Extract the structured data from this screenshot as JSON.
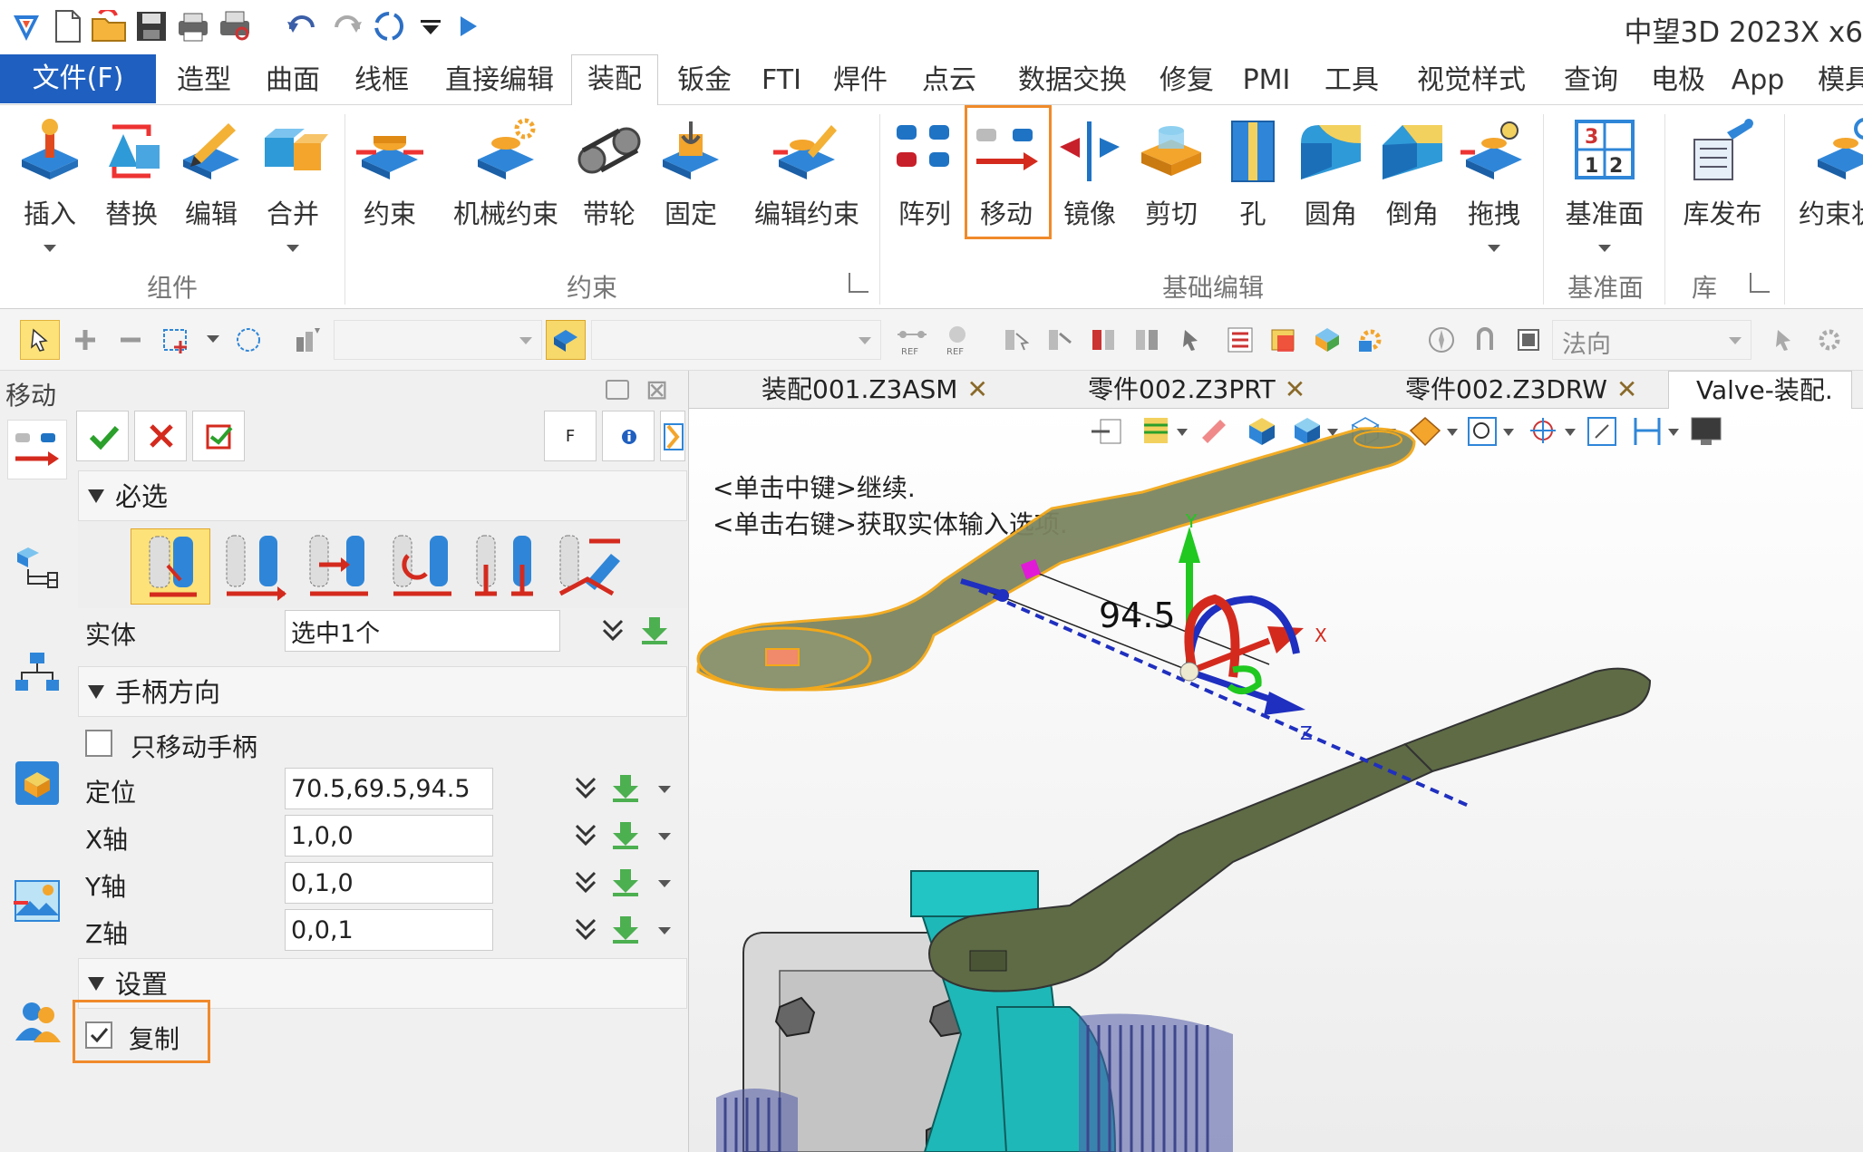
{
  "app": {
    "title": "中望3D 2023X x6"
  },
  "menu": {
    "file": "文件(F)",
    "tabs": [
      "造型",
      "曲面",
      "线框",
      "直接编辑",
      "装配",
      "钣金",
      "FTI",
      "焊件",
      "点云",
      "数据交换",
      "修复",
      "PMI",
      "工具",
      "视觉样式",
      "查询",
      "电极",
      "App",
      "模具"
    ]
  },
  "ribbon": {
    "buttons": [
      "插入",
      "替换",
      "编辑",
      "合并",
      "约束",
      "机械约束",
      "带轮",
      "固定",
      "编辑约束",
      "阵列",
      "移动",
      "镜像",
      "剪切",
      "孔",
      "圆角",
      "倒角",
      "拖拽",
      "基准面",
      "库发布",
      "约束状"
    ],
    "groups": [
      "组件",
      "约束",
      "基础编辑",
      "基准面",
      "库"
    ]
  },
  "toolbar": {
    "direction": "法向"
  },
  "panel": {
    "title": "移动",
    "info_letter": "F",
    "sections": {
      "required": "必选",
      "handle": "手柄方向",
      "settings": "设置"
    },
    "entity_label": "实体",
    "entity_value": "选中1个",
    "move_handle_only": "只移动手柄",
    "location_label": "定位",
    "location_value": "70.5,69.5,94.5",
    "x_label": "X轴",
    "x_value": "1,0,0",
    "y_label": "Y轴",
    "y_value": "0,1,0",
    "z_label": "Z轴",
    "z_value": "0,0,1",
    "copy_label": "复制",
    "copy_checked": true
  },
  "doc_tabs": [
    "装配001.Z3ASM",
    "零件002.Z3PRT",
    "零件002.Z3DRW",
    "Valve-装配."
  ],
  "viewport": {
    "hint1": "<单击中键>继续.",
    "hint2": "<单击右键>获取实体输入选项.",
    "dimension": "94.5",
    "axis_x": "X",
    "axis_y": "Y",
    "axis_z": "Z"
  },
  "colors": {
    "accent": "#1f5fbf",
    "highlight": "#f08a2a",
    "part": "#5e6b45",
    "valve": "#1fb8b8"
  }
}
